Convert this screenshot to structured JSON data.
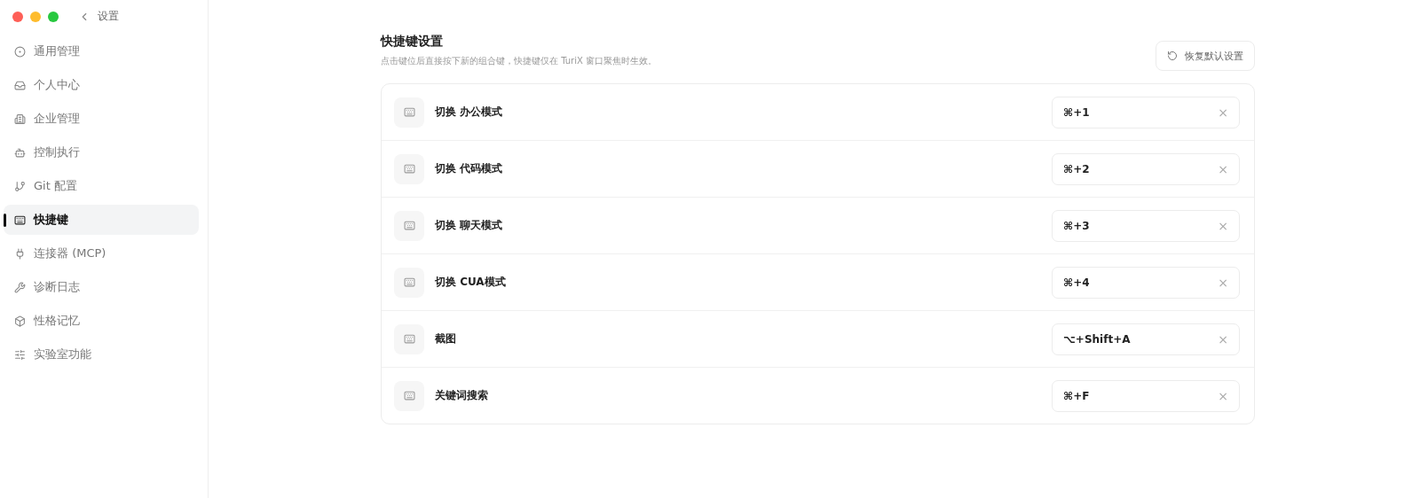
{
  "window": {
    "title": "设置"
  },
  "sidebar": {
    "items": [
      {
        "label": "通用管理",
        "selected": false
      },
      {
        "label": "个人中心",
        "selected": false
      },
      {
        "label": "企业管理",
        "selected": false
      },
      {
        "label": "控制执行",
        "selected": false
      },
      {
        "label": "Git 配置",
        "selected": false
      },
      {
        "label": "快捷键",
        "selected": true
      },
      {
        "label": "连接器 (MCP)",
        "selected": false
      },
      {
        "label": "诊断日志",
        "selected": false
      },
      {
        "label": "性格记忆",
        "selected": false
      },
      {
        "label": "实验室功能",
        "selected": false
      }
    ]
  },
  "header": {
    "title": "快捷键设置",
    "description": "点击键位后直接按下新的组合键，快捷键仅在 TuriX 窗口聚焦时生效。",
    "reset_button": "恢复默认设置"
  },
  "shortcuts": [
    {
      "label": "切换 办公模式",
      "keys": "⌘+1",
      "clear": "×"
    },
    {
      "label": "切换 代码模式",
      "keys": "⌘+2",
      "clear": "×"
    },
    {
      "label": "切换 聊天模式",
      "keys": "⌘+3",
      "clear": "×"
    },
    {
      "label": "切换 CUA模式",
      "keys": "⌘+4",
      "clear": "×"
    },
    {
      "label": "截图",
      "keys": "⌥+Shift+A",
      "clear": "×"
    },
    {
      "label": "关键词搜索",
      "keys": "⌘+F",
      "clear": "×"
    }
  ]
}
